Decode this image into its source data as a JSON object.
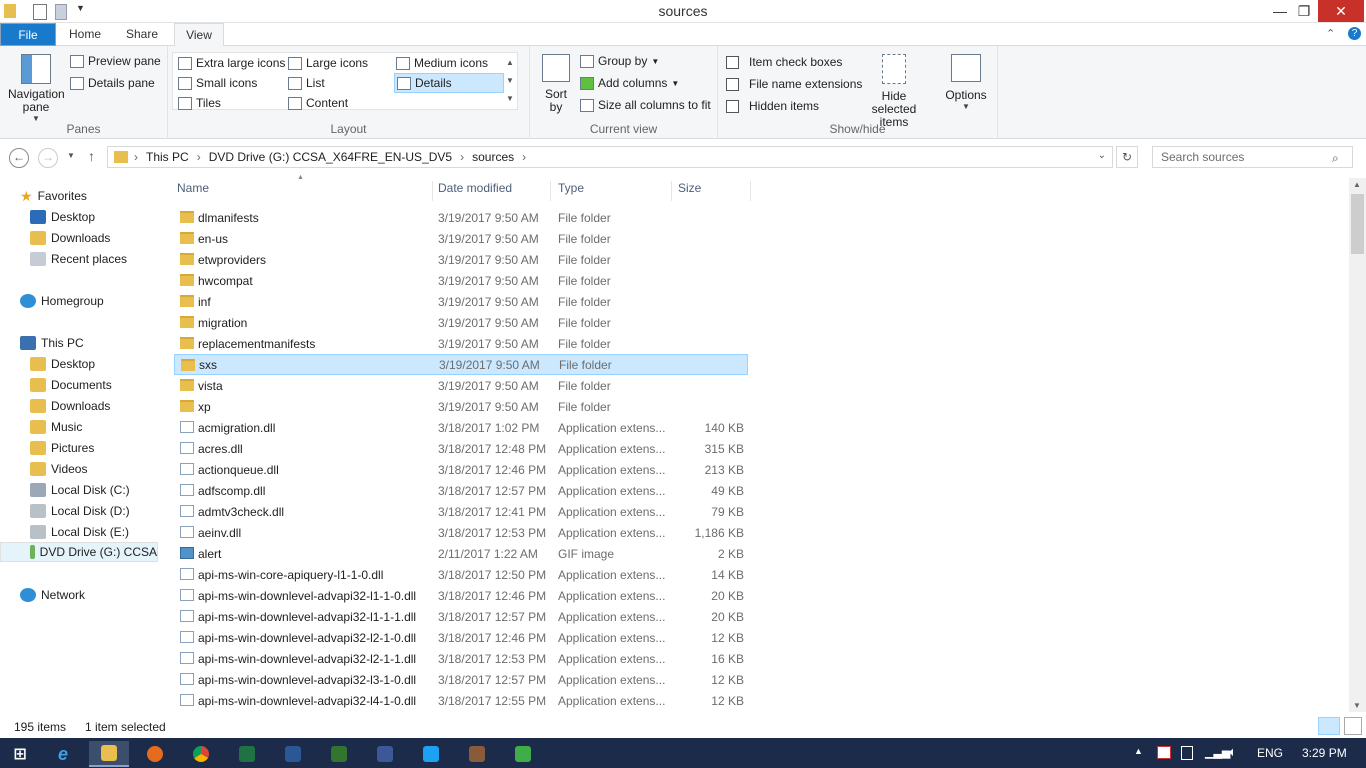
{
  "window": {
    "title": "sources",
    "minimize_glyph": "—",
    "restore_glyph": "❐",
    "close_glyph": "✕"
  },
  "tabs": [
    {
      "label": "File"
    },
    {
      "label": "Home"
    },
    {
      "label": "Share"
    },
    {
      "label": "View"
    }
  ],
  "ribbon": {
    "panes": {
      "label": "Panes",
      "navigation_pane": "Navigation pane",
      "preview_pane": "Preview pane",
      "details_pane": "Details pane"
    },
    "layout": {
      "label": "Layout",
      "items": [
        "Extra large icons",
        "Large icons",
        "Medium icons",
        "Small icons",
        "List",
        "Details",
        "Tiles",
        "Content"
      ],
      "selected": "Details"
    },
    "current_view": {
      "label": "Current view",
      "sort_by": "Sort by",
      "group_by": "Group by",
      "add_columns": "Add columns",
      "size_all_columns": "Size all columns to fit"
    },
    "show_hide": {
      "label": "Show/hide",
      "item_check_boxes": "Item check boxes",
      "file_name_extensions": "File name extensions",
      "hidden_items": "Hidden items",
      "hide_selected_items": "Hide selected items"
    },
    "options": {
      "label": "Options"
    }
  },
  "address": {
    "breadcrumb": [
      "This PC",
      "DVD Drive (G:) CCSA_X64FRE_EN-US_DV5",
      "sources"
    ],
    "search_placeholder": "Search sources"
  },
  "nav": {
    "favorites": "Favorites",
    "favorites_items": [
      "Desktop",
      "Downloads",
      "Recent places"
    ],
    "homegroup": "Homegroup",
    "this_pc": "This PC",
    "this_pc_items": [
      "Desktop",
      "Documents",
      "Downloads",
      "Music",
      "Pictures",
      "Videos",
      "Local Disk (C:)",
      "Local Disk (D:)",
      "Local Disk (E:)",
      "DVD Drive (G:) CCSA"
    ],
    "network": "Network"
  },
  "columns": {
    "name": "Name",
    "date": "Date modified",
    "type": "Type",
    "size": "Size"
  },
  "files": [
    {
      "name": "dlmanifests",
      "date": "3/19/2017 9:50 AM",
      "type": "File folder",
      "size": "",
      "kind": "folder"
    },
    {
      "name": "en-us",
      "date": "3/19/2017 9:50 AM",
      "type": "File folder",
      "size": "",
      "kind": "folder"
    },
    {
      "name": "etwproviders",
      "date": "3/19/2017 9:50 AM",
      "type": "File folder",
      "size": "",
      "kind": "folder"
    },
    {
      "name": "hwcompat",
      "date": "3/19/2017 9:50 AM",
      "type": "File folder",
      "size": "",
      "kind": "folder"
    },
    {
      "name": "inf",
      "date": "3/19/2017 9:50 AM",
      "type": "File folder",
      "size": "",
      "kind": "folder"
    },
    {
      "name": "migration",
      "date": "3/19/2017 9:50 AM",
      "type": "File folder",
      "size": "",
      "kind": "folder"
    },
    {
      "name": "replacementmanifests",
      "date": "3/19/2017 9:50 AM",
      "type": "File folder",
      "size": "",
      "kind": "folder"
    },
    {
      "name": "sxs",
      "date": "3/19/2017 9:50 AM",
      "type": "File folder",
      "size": "",
      "kind": "folder",
      "selected": true
    },
    {
      "name": "vista",
      "date": "3/19/2017 9:50 AM",
      "type": "File folder",
      "size": "",
      "kind": "folder"
    },
    {
      "name": "xp",
      "date": "3/19/2017 9:50 AM",
      "type": "File folder",
      "size": "",
      "kind": "folder"
    },
    {
      "name": "acmigration.dll",
      "date": "3/18/2017 1:02 PM",
      "type": "Application extens...",
      "size": "140 KB",
      "kind": "dll"
    },
    {
      "name": "acres.dll",
      "date": "3/18/2017 12:48 PM",
      "type": "Application extens...",
      "size": "315 KB",
      "kind": "dll"
    },
    {
      "name": "actionqueue.dll",
      "date": "3/18/2017 12:46 PM",
      "type": "Application extens...",
      "size": "213 KB",
      "kind": "dll"
    },
    {
      "name": "adfscomp.dll",
      "date": "3/18/2017 12:57 PM",
      "type": "Application extens...",
      "size": "49 KB",
      "kind": "dll"
    },
    {
      "name": "admtv3check.dll",
      "date": "3/18/2017 12:41 PM",
      "type": "Application extens...",
      "size": "79 KB",
      "kind": "dll"
    },
    {
      "name": "aeinv.dll",
      "date": "3/18/2017 12:53 PM",
      "type": "Application extens...",
      "size": "1,186 KB",
      "kind": "dll"
    },
    {
      "name": "alert",
      "date": "2/11/2017 1:22 AM",
      "type": "GIF image",
      "size": "2 KB",
      "kind": "gif"
    },
    {
      "name": "api-ms-win-core-apiquery-l1-1-0.dll",
      "date": "3/18/2017 12:50 PM",
      "type": "Application extens...",
      "size": "14 KB",
      "kind": "dll"
    },
    {
      "name": "api-ms-win-downlevel-advapi32-l1-1-0.dll",
      "date": "3/18/2017 12:46 PM",
      "type": "Application extens...",
      "size": "20 KB",
      "kind": "dll"
    },
    {
      "name": "api-ms-win-downlevel-advapi32-l1-1-1.dll",
      "date": "3/18/2017 12:57 PM",
      "type": "Application extens...",
      "size": "20 KB",
      "kind": "dll"
    },
    {
      "name": "api-ms-win-downlevel-advapi32-l2-1-0.dll",
      "date": "3/18/2017 12:46 PM",
      "type": "Application extens...",
      "size": "12 KB",
      "kind": "dll"
    },
    {
      "name": "api-ms-win-downlevel-advapi32-l2-1-1.dll",
      "date": "3/18/2017 12:53 PM",
      "type": "Application extens...",
      "size": "16 KB",
      "kind": "dll"
    },
    {
      "name": "api-ms-win-downlevel-advapi32-l3-1-0.dll",
      "date": "3/18/2017 12:57 PM",
      "type": "Application extens...",
      "size": "12 KB",
      "kind": "dll"
    },
    {
      "name": "api-ms-win-downlevel-advapi32-l4-1-0.dll",
      "date": "3/18/2017 12:55 PM",
      "type": "Application extens...",
      "size": "12 KB",
      "kind": "dll"
    }
  ],
  "status": {
    "item_count": "195 items",
    "selection": "1 item selected"
  },
  "taskbar": {
    "apps": [
      "start-button",
      "internet-explorer",
      "file-explorer",
      "firefox",
      "chrome",
      "excel",
      "word",
      "project",
      "facebook",
      "twitter",
      "paint",
      "app-green"
    ],
    "language": "ENG",
    "time": "3:29 PM"
  },
  "colors": {
    "accent": "#1979ca",
    "selection": "#cce8ff",
    "taskbar": "#1c2b4a"
  }
}
